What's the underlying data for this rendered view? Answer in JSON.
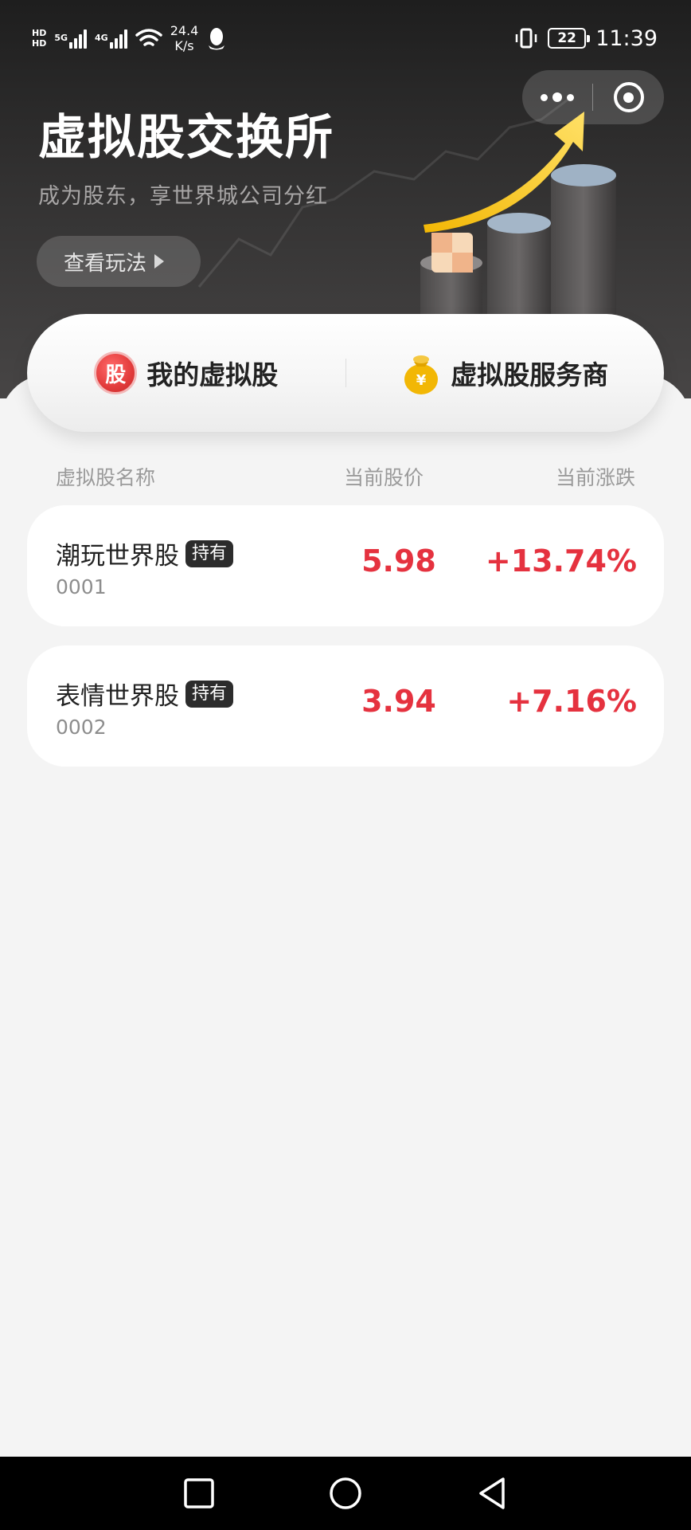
{
  "status_bar": {
    "hd_1": "HD",
    "hd_2": "HD",
    "net_1": "5G",
    "net_2": "4G",
    "speed_value": "24.4",
    "speed_unit": "K/s",
    "battery": "22",
    "time": "11:39"
  },
  "header": {
    "title": "虚拟股交换所",
    "subtitle": "成为股东，享世界城公司分红",
    "rules_button": "查看玩法"
  },
  "tabs": [
    {
      "icon_text": "股",
      "label": "我的虚拟股",
      "icon": "stock-badge-icon"
    },
    {
      "label": "虚拟股服务商",
      "icon": "money-bag-icon"
    }
  ],
  "table": {
    "headers": {
      "name": "虚拟股名称",
      "price": "当前股价",
      "change": "当前涨跌"
    },
    "rows": [
      {
        "name": "潮玩世界股",
        "tag": "持有",
        "code": "0001",
        "price": "5.98",
        "change": "+13.74%"
      },
      {
        "name": "表情世界股",
        "tag": "持有",
        "code": "0002",
        "price": "3.94",
        "change": "+7.16%"
      }
    ]
  },
  "colors": {
    "accent_red": "#e5323f",
    "header_dark": "#2e2d2d",
    "background": "#f4f4f4",
    "gold": "#f4c20d"
  }
}
